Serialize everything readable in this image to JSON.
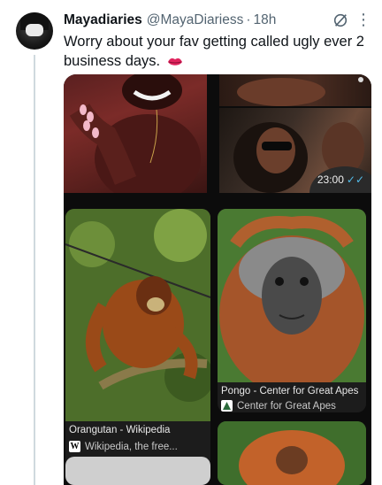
{
  "tweet": {
    "display_name": "Mayadiaries",
    "handle": "@MayaDiariess",
    "separator": "·",
    "time": "18h",
    "text": "Worry about your fav getting called ugly ever 2 business days."
  },
  "media": {
    "chat_timestamp": "23:00",
    "results": [
      {
        "title": "Orangutan - Wikipedia",
        "source": "Wikipedia, the free...",
        "favicon": "wikipedia-icon"
      },
      {
        "title": "Pongo - Center for Great Apes",
        "source": "Center for Great Apes",
        "favicon": "ape-center-icon"
      }
    ]
  },
  "icons": [
    "grok-icon",
    "more-icon",
    "lips-icon"
  ],
  "colors": {
    "text": "#0f1419",
    "secondary": "#536471",
    "thread": "#cfd9de",
    "lips": "#e0245e"
  }
}
